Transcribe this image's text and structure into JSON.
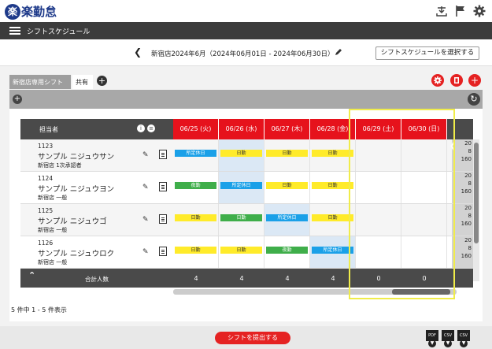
{
  "app": {
    "logo_mark": "楽",
    "logo_text": "楽勤怠"
  },
  "top_icons": [
    "inbox-download-icon",
    "flag-icon",
    "gear-icon"
  ],
  "nav": {
    "title": "シフトスケジュール"
  },
  "schedule": {
    "title": "新宿店2024年6月（2024年06月01日 - 2024年06月30日）",
    "select_button": "シフトスケジュールを選択する"
  },
  "tabs": [
    {
      "label": "新宿店専用シフト",
      "active": true
    },
    {
      "label": "共有",
      "active": false
    }
  ],
  "table": {
    "header_label": "担当者",
    "days": [
      {
        "label": "06/25 (火)"
      },
      {
        "label": "06/26 (水)"
      },
      {
        "label": "06/27 (木)"
      },
      {
        "label": "06/28 (金)"
      },
      {
        "label": "06/29 (土)"
      },
      {
        "label": "06/30 (日)"
      }
    ],
    "employees": [
      {
        "id": "1123",
        "name": "サンプル ニジュウサン",
        "role": "新宿店 1次承認者",
        "shifts": [
          {
            "label": "所定休日",
            "color": "blue"
          },
          {
            "label": "日勤",
            "color": "yellow"
          },
          {
            "label": "日勤",
            "color": "yellow"
          },
          {
            "label": "日勤",
            "color": "yellow"
          }
        ],
        "stats": [
          "20",
          "8",
          "160"
        ]
      },
      {
        "id": "1124",
        "name": "サンプル ニジュウヨン",
        "role": "新宿店 一般",
        "shifts": [
          {
            "label": "夜勤",
            "color": "green"
          },
          {
            "label": "所定休日",
            "color": "blue"
          },
          {
            "label": "日勤",
            "color": "yellow"
          },
          {
            "label": "日勤",
            "color": "yellow"
          }
        ],
        "stats": [
          "20",
          "8",
          "160"
        ]
      },
      {
        "id": "1125",
        "name": "サンプル ニジュウゴ",
        "role": "新宿店 一般",
        "shifts": [
          {
            "label": "日勤",
            "color": "yellow"
          },
          {
            "label": "日勤",
            "color": "green"
          },
          {
            "label": "所定休日",
            "color": "blue"
          },
          {
            "label": "日勤",
            "color": "yellow"
          }
        ],
        "stats": [
          "20",
          "8",
          "160"
        ]
      },
      {
        "id": "1126",
        "name": "サンプル ニジュウロク",
        "role": "新宿店 一般",
        "shifts": [
          {
            "label": "日勤",
            "color": "yellow"
          },
          {
            "label": "日勤",
            "color": "yellow"
          },
          {
            "label": "夜勤",
            "color": "green"
          },
          {
            "label": "所定休日",
            "color": "blue"
          }
        ],
        "stats": [
          "20",
          "8",
          "160"
        ]
      }
    ],
    "footer_label": "合計人数",
    "totals": [
      "4",
      "4",
      "4",
      "4",
      "0",
      "0"
    ]
  },
  "pagination_text": "5 件中 1 - 5 件表示",
  "submit_button": "シフトを提出する",
  "exports": [
    "PDF",
    "CSV",
    "CSV"
  ],
  "colors": {
    "accent_red": "#e52222",
    "highlight_yellow": "#f0ec4a"
  }
}
